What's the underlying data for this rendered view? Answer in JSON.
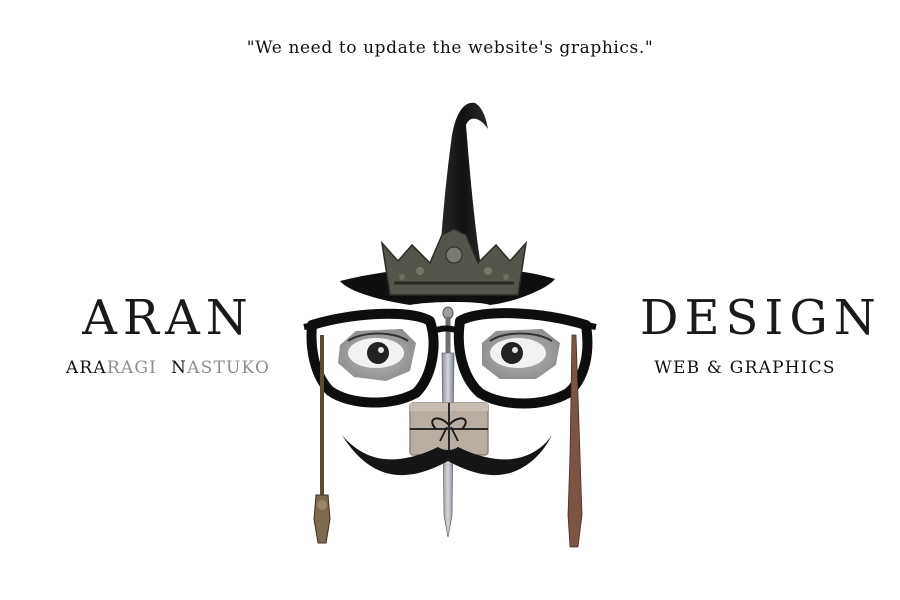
{
  "quote": {
    "text": "\"We need to update the website's graphics.\""
  },
  "brand_left": {
    "title": "ARAN",
    "subtitle_parts": [
      {
        "text": "ARA",
        "tone": "dark"
      },
      {
        "text": "RAGI",
        "tone": "grey"
      },
      {
        "text": "N",
        "tone": "dark"
      },
      {
        "text": "ASTUKO",
        "tone": "grey"
      }
    ]
  },
  "brand_right": {
    "title": "DESIGN",
    "subtitle": "WEB & GRAPHICS"
  },
  "illustration": {
    "elements": [
      "witch-hat-icon",
      "crown-icon",
      "glasses-icon",
      "eye-icon",
      "sword-icon",
      "gift-box-icon",
      "mustache-icon",
      "wand-icon"
    ],
    "colors": {
      "ink": "#111111",
      "crown": "#5a5a50",
      "steel": "#a8adb2",
      "box": "#b8aca0",
      "wand_left": "#6b5a42",
      "wand_right": "#7a5546"
    }
  }
}
